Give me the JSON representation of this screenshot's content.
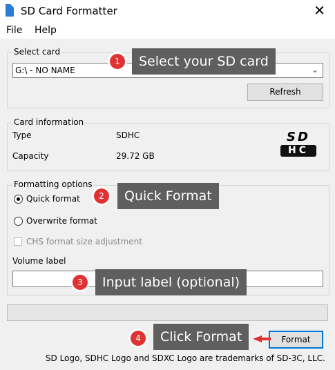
{
  "window": {
    "title": "SD Card Formatter",
    "close_glyph": "✕"
  },
  "menu": {
    "items": [
      {
        "label": "File"
      },
      {
        "label": "Help"
      }
    ]
  },
  "select_card": {
    "group_label": "Select card",
    "selected": "G:\\ - NO NAME",
    "refresh_label": "Refresh"
  },
  "card_info": {
    "group_label": "Card information",
    "type_label": "Type",
    "type_value": "SDHC",
    "capacity_label": "Capacity",
    "capacity_value": "29.72 GB",
    "logo_text": "SD",
    "logo_sub": "HC"
  },
  "formatting_options": {
    "group_label": "Formatting options",
    "quick_format": "Quick format",
    "overwrite_format": "Overwrite format",
    "chs_adjustment": "CHS format size adjustment",
    "selected": "quick_format"
  },
  "volume": {
    "label": "Volume label",
    "value": ""
  },
  "progress": {
    "fraction": 0
  },
  "actions": {
    "format_label": "Format"
  },
  "footer": {
    "text": "SD Logo, SDHC Logo and SDXC Logo are trademarks of SD-3C, LLC."
  },
  "annotations": [
    {
      "step": "1",
      "text": "Select your SD card"
    },
    {
      "step": "2",
      "text": "Quick Format"
    },
    {
      "step": "3",
      "text": "Input label (optional)"
    },
    {
      "step": "4",
      "text": "Click Format"
    }
  ],
  "colors": {
    "badge": "#e03232",
    "callout_bg": "#5f5f5f",
    "format_border": "#0078d7",
    "app_icon": "#2a7bd4",
    "arrow": "#e03232"
  }
}
